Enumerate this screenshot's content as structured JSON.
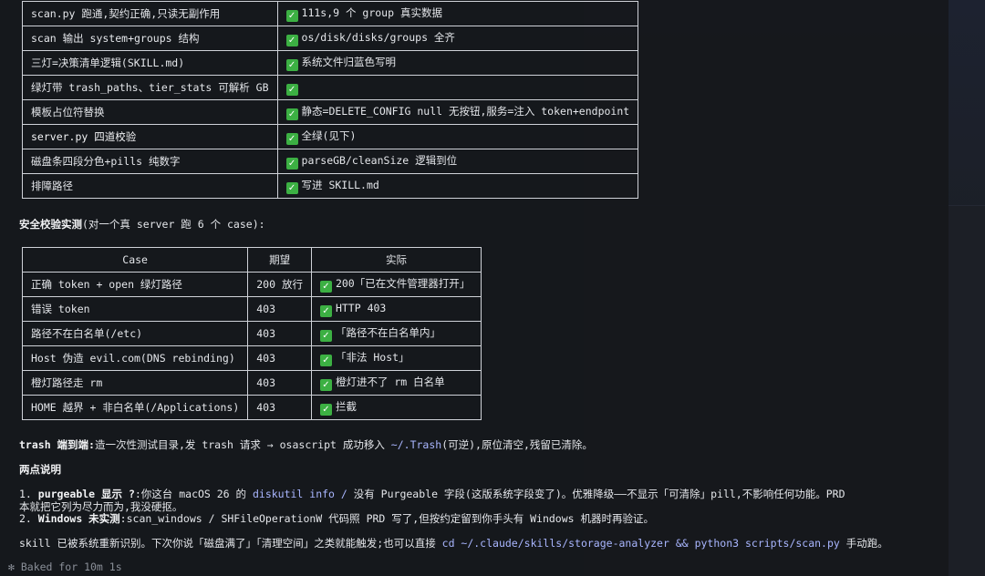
{
  "table1": {
    "rows": [
      {
        "item": "scan.py 跑通,契约正确,只读无副作用",
        "result": "111s,9 个 group 真实数据",
        "bold": false
      },
      {
        "item": "scan 输出 system+groups 结构",
        "result": "os/disk/disks/groups 全齐",
        "bold": false
      },
      {
        "item": "三灯=决策清单逻辑(SKILL.md)",
        "result": "系统文件归蓝色写明",
        "bold": false
      },
      {
        "item": "绿灯带 trash_paths、tier_stats 可解析 GB",
        "result": "",
        "bold": false
      },
      {
        "item": "模板占位符替换",
        "result": "静态=DELETE_CONFIG null 无按钮,服务=注入 token+endpoint",
        "bold": false
      },
      {
        "item": "server.py 四道校验",
        "result": "全绿(见下)",
        "bold": true
      },
      {
        "item": "磁盘条四段分色+pills 纯数字",
        "result": "parseGB/cleanSize 逻辑到位",
        "bold": false
      },
      {
        "item": "排障路径",
        "result": "写进 SKILL.md",
        "bold": false
      }
    ]
  },
  "section_security": {
    "bold": "安全校验实测",
    "rest": "(对一个真 server 跑 6 个 case):"
  },
  "table2": {
    "headers": [
      "Case",
      "期望",
      "实际"
    ],
    "rows": [
      {
        "case": "正确 token + open 绿灯路径",
        "expect": "200 放行",
        "actual": "200「已在文件管理器打开」"
      },
      {
        "case": "错误 token",
        "expect": "403",
        "actual": "HTTP 403"
      },
      {
        "case": "路径不在白名单(/etc)",
        "expect": "403",
        "actual": "「路径不在白名单内」"
      },
      {
        "case": "Host 伪造 evil.com(DNS rebinding)",
        "expect": "403",
        "actual": "「非法 Host」"
      },
      {
        "case": "橙灯路径走 rm",
        "expect": "403",
        "actual": "橙灯进不了 rm 白名单"
      },
      {
        "case": "HOME 越界 + 非白名单(/Applications)",
        "expect": "403",
        "actual": "拦截"
      }
    ]
  },
  "trash": {
    "bold": "trash 端到端:",
    "text1": "造一次性测试目录,发 trash 请求 → osascript 成功移入 ",
    "code": "~/.Trash",
    "text2": "(可逆),原位清空,残留已清除。"
  },
  "notes": {
    "title": "两点说明",
    "n1_prefix": "1. ",
    "n1_bold": "purgeable 显示 ?",
    "n1_text1": ":你这台 macOS 26 的 ",
    "n1_code": "diskutil info /",
    "n1_text2": " 没有 Purgeable 字段(这版系统字段变了)。优雅降级——不显示「可清除」pill,不影响任何功能。PRD",
    "n1_cont": "本就把它列为尽力而为,我没硬抠。",
    "n2_prefix": "2. ",
    "n2_bold": "Windows 未实测",
    "n2_text": ":scan_windows / SHFileOperationW 代码照 PRD 写了,但按约定留到你手头有 Windows 机器时再验证。"
  },
  "closing": {
    "text1": "skill 已被系统重新识别。下次你说「磁盘满了」「清理空间」之类就能触发;也可以直接 ",
    "code": "cd ~/.claude/skills/storage-analyzer && python3 scripts/scan.py",
    "text2": " 手动跑。"
  },
  "status": {
    "text": "✻ Baked for 10m 1s"
  },
  "icons": {
    "check": "white-heavy-check-mark"
  },
  "colors": {
    "background": "#16181c",
    "check": "#3cb043",
    "code": "#a9b6ff",
    "border": "#cfd2d8"
  }
}
